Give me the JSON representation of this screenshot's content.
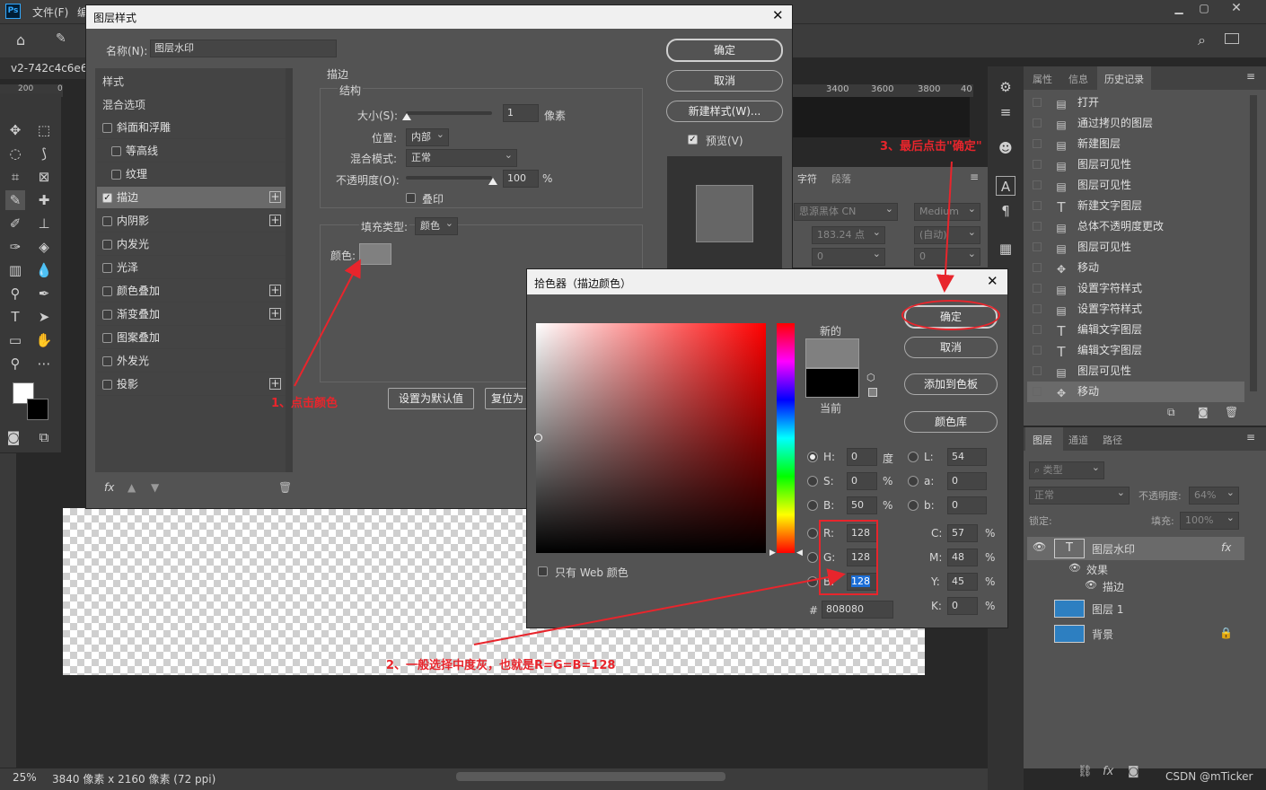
{
  "app": {
    "menu_file": "文件(F)",
    "menu_edit": "编",
    "doc_tab": "v2-742c4c6e63",
    "zoom": "25%",
    "doc_info": "3840 像素 x 2160 像素 (72 ppi)",
    "ruler_top": [
      "200",
      "0"
    ],
    "ruler_right": [
      "00",
      "3400",
      "3600",
      "3800",
      "40"
    ]
  },
  "layer_style": {
    "title": "图层样式",
    "name_label": "名称(N):",
    "name_value": "图层水印",
    "ok": "确定",
    "cancel": "取消",
    "new_style": "新建样式(W)...",
    "preview": "预览(V)",
    "styles_header": "样式",
    "blend_options": "混合选项",
    "items": [
      {
        "label": "斜面和浮雕",
        "checked": false,
        "plus": false
      },
      {
        "label": "等高线",
        "checked": false,
        "plus": false
      },
      {
        "label": "纹理",
        "checked": false,
        "plus": false
      },
      {
        "label": "描边",
        "checked": true,
        "plus": true
      },
      {
        "label": "内阴影",
        "checked": false,
        "plus": true
      },
      {
        "label": "内发光",
        "checked": false,
        "plus": false
      },
      {
        "label": "光泽",
        "checked": false,
        "plus": false
      },
      {
        "label": "颜色叠加",
        "checked": false,
        "plus": true
      },
      {
        "label": "渐变叠加",
        "checked": false,
        "plus": true
      },
      {
        "label": "图案叠加",
        "checked": false,
        "plus": false
      },
      {
        "label": "外发光",
        "checked": false,
        "plus": false
      },
      {
        "label": "投影",
        "checked": false,
        "plus": true
      }
    ],
    "fx": "fx",
    "stroke_title": "描边",
    "structure": "结构",
    "size_label": "大小(S):",
    "size_value": "1",
    "size_unit": "像素",
    "position_label": "位置:",
    "position_value": "内部",
    "blend_label": "混合模式:",
    "blend_value": "正常",
    "opacity_label": "不透明度(O):",
    "opacity_value": "100",
    "opacity_unit": "%",
    "overprint": "叠印",
    "fill_type_label": "填充类型:",
    "fill_type_value": "颜色",
    "color_label": "颜色:",
    "set_default": "设置为默认值",
    "reset_default": "复位为"
  },
  "picker": {
    "title": "拾色器（描边颜色）",
    "ok": "确定",
    "cancel": "取消",
    "add_swatch": "添加到色板",
    "color_lib": "颜色库",
    "new_label": "新的",
    "current_label": "当前",
    "web_only": "只有 Web 颜色",
    "fields": {
      "H": "0",
      "S": "0",
      "Bv": "50",
      "R": "128",
      "G": "128",
      "B": "128",
      "L": "54",
      "a": "0",
      "b": "0",
      "C": "57",
      "M": "48",
      "Y": "45",
      "K": "0",
      "hex": "808080"
    },
    "labels": {
      "H": "H:",
      "S": "S:",
      "Bv": "B:",
      "R": "R:",
      "G": "G:",
      "B": "B:",
      "L": "L:",
      "a": "a:",
      "b": "b:",
      "C": "C:",
      "M": "M:",
      "Y": "Y:",
      "K": "K:",
      "hex": "#",
      "deg": "度",
      "pct": "%"
    },
    "new_color": "#808080",
    "current_color": "#000000"
  },
  "char_panel": {
    "tab1": "字符",
    "tab2": "段落",
    "font": "思源黑体 CN",
    "weight": "Medium",
    "size": "183.24 点",
    "leading": "(自动)",
    "tracking": "0",
    "kerning": "0"
  },
  "history": {
    "tab_props": "属性",
    "tab_info": "信息",
    "tab_history": "历史记录",
    "items": [
      {
        "icon": "doc",
        "label": "打开"
      },
      {
        "icon": "doc",
        "label": "通过拷贝的图层"
      },
      {
        "icon": "doc",
        "label": "新建图层"
      },
      {
        "icon": "doc",
        "label": "图层可见性"
      },
      {
        "icon": "doc",
        "label": "图层可见性"
      },
      {
        "icon": "T",
        "label": "新建文字图层"
      },
      {
        "icon": "doc",
        "label": "总体不透明度更改"
      },
      {
        "icon": "doc",
        "label": "图层可见性"
      },
      {
        "icon": "move",
        "label": "移动"
      },
      {
        "icon": "doc",
        "label": "设置字符样式"
      },
      {
        "icon": "doc",
        "label": "设置字符样式"
      },
      {
        "icon": "T",
        "label": "编辑文字图层"
      },
      {
        "icon": "T",
        "label": "编辑文字图层"
      },
      {
        "icon": "doc",
        "label": "图层可见性"
      },
      {
        "icon": "move",
        "label": "移动"
      }
    ]
  },
  "layers": {
    "tab_layers": "图层",
    "tab_channels": "通道",
    "tab_paths": "路径",
    "filter": "类型",
    "blend": "正常",
    "opacity_label": "不透明度:",
    "opacity_value": "64%",
    "lock_label": "锁定:",
    "fill_label": "填充:",
    "fill_value": "100%",
    "items": [
      {
        "name": "图层水印",
        "type": "text"
      },
      {
        "name": "效果",
        "type": "sub"
      },
      {
        "name": "描边",
        "type": "sub2"
      },
      {
        "name": "图层 1",
        "type": "image"
      },
      {
        "name": "背景",
        "type": "image"
      }
    ],
    "fx": "fx"
  },
  "annotations": {
    "a1": "1、点击颜色",
    "a2": "2、一般选择中度灰，也就是R=G=B=128",
    "a3": "3、最后点击\"确定\""
  },
  "watermark": "CSDN @mTicker"
}
